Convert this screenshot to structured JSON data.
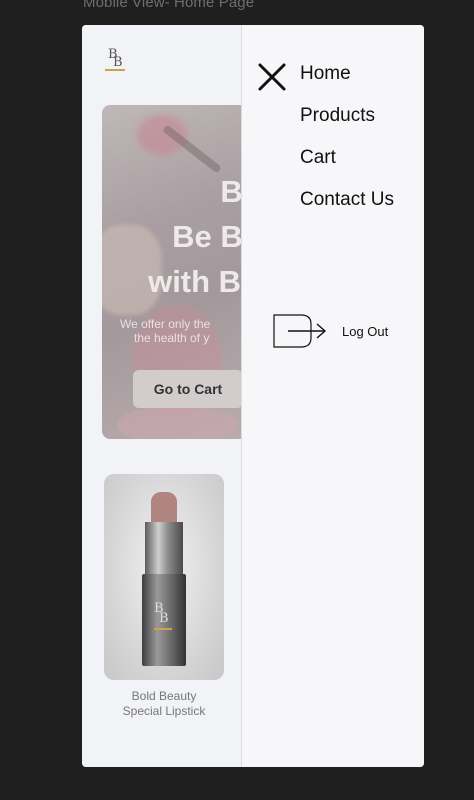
{
  "frame_label": "Mobile View- Home Page",
  "logo": {
    "top": "B",
    "bottom": "B"
  },
  "hero": {
    "title_lines": [
      "Be",
      "Be Be",
      "with Bo"
    ],
    "subtitle_lines": [
      "We offer only the",
      "the health of y"
    ],
    "button_label": "Go to Cart"
  },
  "product": {
    "name_line1": "Bold Beauty",
    "name_line2": "Special  Lipstick"
  },
  "menu": {
    "items": [
      {
        "label": "Home"
      },
      {
        "label": "Products"
      },
      {
        "label": "Cart"
      },
      {
        "label": "Contact Us"
      }
    ],
    "logout_label": "Log Out",
    "close_icon": "close-icon",
    "logout_icon": "logout-icon"
  }
}
